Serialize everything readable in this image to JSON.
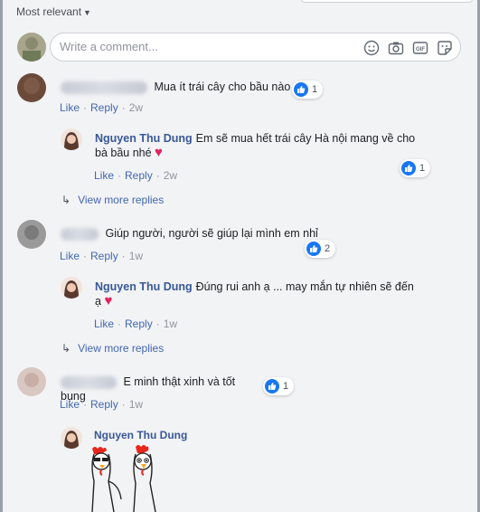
{
  "sort": {
    "label": "Most relevant"
  },
  "composer": {
    "placeholder": "Write a comment..."
  },
  "comments": [
    {
      "text": "Mua ít trái cây cho bầu nào",
      "likes": "1",
      "actions": {
        "like": "Like",
        "reply": "Reply",
        "time": "2w"
      },
      "reply": {
        "author": "Nguyen Thu Dung",
        "text": "Em sẽ mua hết trái cây Hà nội mang về cho bà bầu nhé",
        "likes": "1",
        "actions": {
          "like": "Like",
          "reply": "Reply",
          "time": "2w"
        }
      },
      "more": "View more replies"
    },
    {
      "text": "Giúp người, người sẽ giúp lại mình em nhỉ",
      "likes": "2",
      "actions": {
        "like": "Like",
        "reply": "Reply",
        "time": "1w"
      },
      "reply": {
        "author": "Nguyen Thu Dung",
        "text": "Đúng rui anh ạ ... may mắn tự nhiên sẽ đến ạ",
        "actions": {
          "like": "Like",
          "reply": "Reply",
          "time": "1w"
        }
      },
      "more": "View more replies"
    },
    {
      "text": "E minh thật xinh và tốt bụng",
      "likes": "1",
      "actions": {
        "like": "Like",
        "reply": "Reply",
        "time": "1w"
      },
      "reply": {
        "author": "Nguyen Thu Dung",
        "sticker": "rooster-sticker"
      }
    }
  ],
  "icons": [
    "emoji-icon",
    "camera-icon",
    "gif-icon",
    "sticker-icon",
    "like-icon",
    "reply-arrow-icon",
    "heart-icon"
  ],
  "colors": {
    "link": "#4267b2",
    "author": "#385898",
    "like": "#1877f2",
    "heart": "#e0245e",
    "bubble": "#f2f3f5"
  }
}
